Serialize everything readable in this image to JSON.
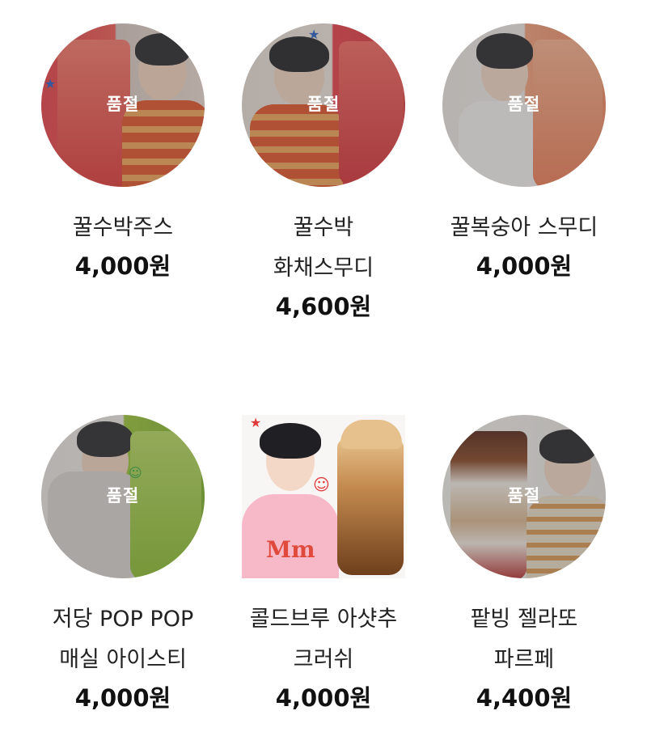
{
  "soldout_label": "품절",
  "products": [
    {
      "name": "꿀수박주스",
      "price": "4,000원",
      "sold_out": true
    },
    {
      "name": "꿀수박 화채스무디",
      "price": "4,600원",
      "sold_out": true
    },
    {
      "name": "꿀복숭아 스무디",
      "price": "4,000원",
      "sold_out": true
    },
    {
      "name": "저당 POP POP 매실 아이스티",
      "price": "4,000원",
      "sold_out": true
    },
    {
      "name": "콜드브루 아샷추 크러쉬",
      "price": "4,000원",
      "sold_out": false
    },
    {
      "name": "팥빙 젤라또 파르페",
      "price": "4,400원",
      "sold_out": true
    }
  ],
  "colors": {
    "watermelon": "#e8434b",
    "peach": "#f2a07b",
    "plum_green": "#9cc63a",
    "coffee": "#b0703a",
    "pink_shirt": "#f7b8c8"
  },
  "icons": [
    "star-icon",
    "smiley-icon"
  ]
}
